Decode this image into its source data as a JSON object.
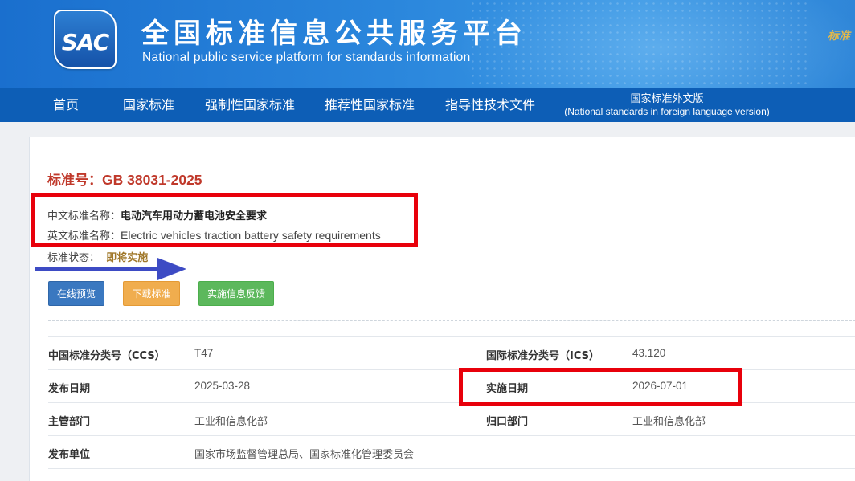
{
  "header": {
    "logo_text": "SAC",
    "title": "全国标准信息公共服务平台",
    "subtitle": "National public service platform  for standards information",
    "corner_text": "标准"
  },
  "nav": {
    "items": [
      "首页",
      "国家标准",
      "强制性国家标准",
      "推荐性国家标准",
      "指导性技术文件"
    ],
    "foreign": {
      "label_cn": "国家标准外文版",
      "label_en": "(National standards in foreign language version)"
    }
  },
  "standard": {
    "number_label": "标准号：",
    "number": "GB 38031-2025",
    "cn_name_label": "中文标准名称：",
    "cn_name": "电动汽车用动力蓄电池安全要求",
    "en_name_label": "英文标准名称：",
    "en_name": "Electric vehicles traction battery safety requirements",
    "status_label": "标准状态：",
    "status": "即将实施"
  },
  "buttons": {
    "preview": "在线预览",
    "download": "下载标准",
    "feedback": "实施信息反馈"
  },
  "details": {
    "ccs_label": "中国标准分类号（CCS）",
    "ccs": "T47",
    "ics_label": "国际标准分类号（ICS）",
    "ics": "43.120",
    "publish_label": "发布日期",
    "publish_date": "2025-03-28",
    "impl_label": "实施日期",
    "impl_date": "2026-07-01",
    "dept_label": "主管部门",
    "dept": "工业和信息化部",
    "owner_label": "归口部门",
    "owner": "工业和信息化部",
    "issuer_label": "发布单位",
    "issuer": "国家市场监督管理总局、国家标准化管理委员会"
  },
  "colors": {
    "title_red": "#c0392b",
    "annotation_red": "#e8000b",
    "annotation_arrow": "#3d4bc4",
    "nav_bg": "#0d5eb6",
    "status_text": "#a0782a"
  }
}
